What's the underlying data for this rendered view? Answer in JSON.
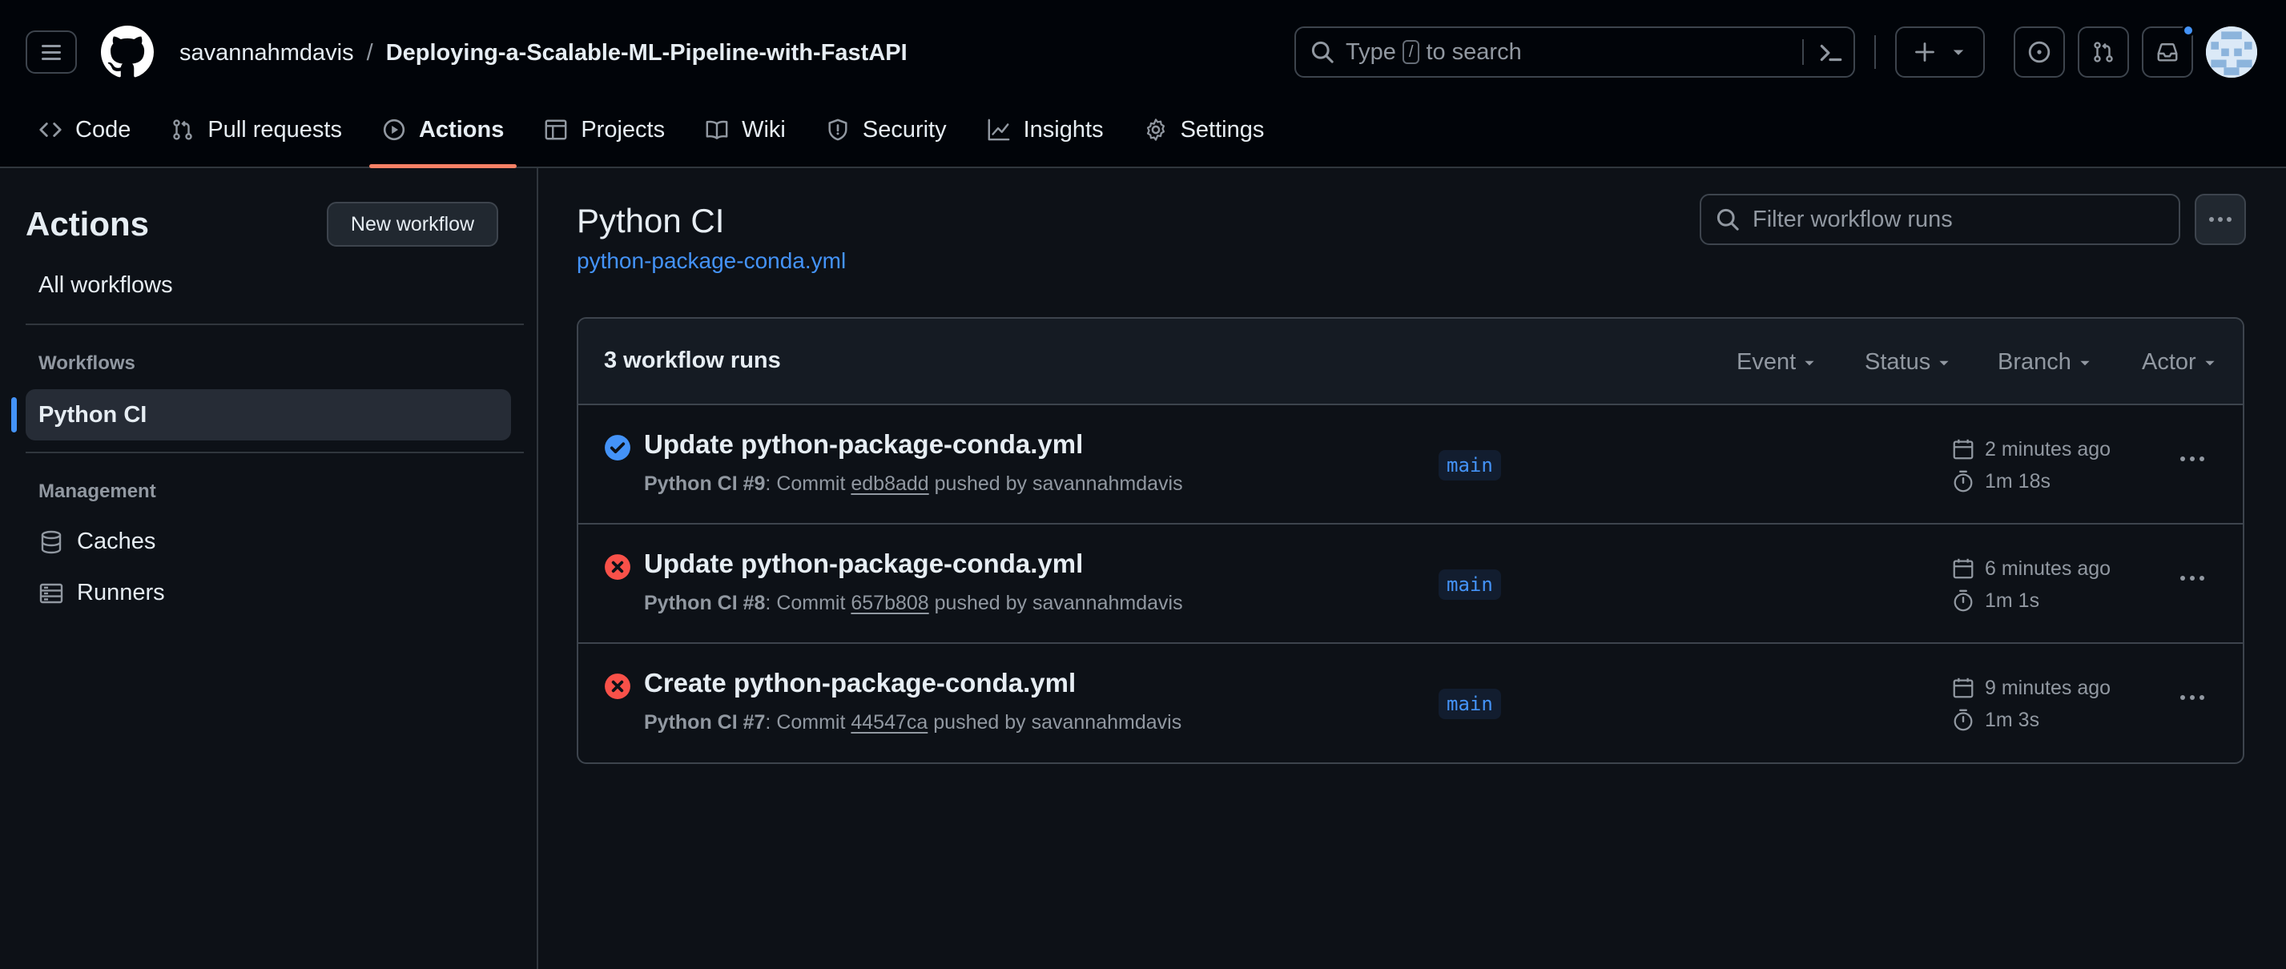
{
  "header": {
    "owner": "savannahmdavis",
    "separator": "/",
    "repo": "Deploying-a-Scalable-ML-Pipeline-with-FastAPI",
    "search": {
      "prefix": "Type",
      "key": "/",
      "suffix": "to search"
    }
  },
  "repo_nav": [
    {
      "label": "Code",
      "icon": "code-icon"
    },
    {
      "label": "Pull requests",
      "icon": "pull-request-icon"
    },
    {
      "label": "Actions",
      "icon": "play-icon",
      "active": true
    },
    {
      "label": "Projects",
      "icon": "table-icon"
    },
    {
      "label": "Wiki",
      "icon": "book-icon"
    },
    {
      "label": "Security",
      "icon": "shield-icon"
    },
    {
      "label": "Insights",
      "icon": "graph-icon"
    },
    {
      "label": "Settings",
      "icon": "gear-icon"
    }
  ],
  "sidebar": {
    "title": "Actions",
    "new_workflow": "New workflow",
    "all_workflows": "All workflows",
    "workflows_heading": "Workflows",
    "active_workflow": "Python CI",
    "management_heading": "Management",
    "management_items": [
      {
        "label": "Caches",
        "icon": "database-icon"
      },
      {
        "label": "Runners",
        "icon": "server-icon"
      }
    ]
  },
  "main": {
    "title": "Python CI",
    "file": "python-package-conda.yml",
    "filter_placeholder": "Filter workflow runs",
    "runs_count": "3 workflow runs",
    "filters": [
      "Event",
      "Status",
      "Branch",
      "Actor"
    ],
    "runs": [
      {
        "status": "success",
        "title": "Update python-package-conda.yml",
        "workflow": "Python CI #9",
        "commit_prefix": ": Commit",
        "sha": "edb8add",
        "pushed_by": "pushed by savannahmdavis",
        "branch": "main",
        "when": "2 minutes ago",
        "duration": "1m 18s"
      },
      {
        "status": "failure",
        "title": "Update python-package-conda.yml",
        "workflow": "Python CI #8",
        "commit_prefix": ": Commit",
        "sha": "657b808",
        "pushed_by": "pushed by savannahmdavis",
        "branch": "main",
        "when": "6 minutes ago",
        "duration": "1m 1s"
      },
      {
        "status": "failure",
        "title": "Create python-package-conda.yml",
        "workflow": "Python CI #7",
        "commit_prefix": ": Commit",
        "sha": "44547ca",
        "pushed_by": "pushed by savannahmdavis",
        "branch": "main",
        "when": "9 minutes ago",
        "duration": "1m 3s"
      }
    ]
  },
  "colors": {
    "accent": "#4493f8",
    "success": "#4493f8",
    "failure": "#f85149",
    "active_tab_underline": "#f78166"
  }
}
